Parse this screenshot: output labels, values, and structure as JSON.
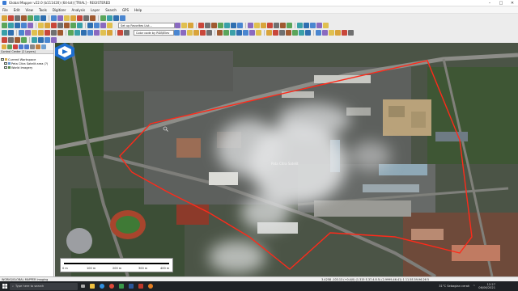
{
  "window": {
    "title": "Global Mapper v22.0 (b111420) (64-bit) [TRIAL] - REGISTERED",
    "controls": [
      "–",
      "□",
      "✕"
    ]
  },
  "menu": [
    "File",
    "Edit",
    "View",
    "Tools",
    "Digitizer",
    "Analysis",
    "Layer",
    "Search",
    "GPS",
    "Help"
  ],
  "toolbar": {
    "favorites_select": "Set up Favorites List...",
    "color_select": "Color code by RGB/Elev"
  },
  "control_center": {
    "header": "Control Center (2 Layers)",
    "tree": [
      {
        "label": "Current Workspace",
        "checked": true
      },
      {
        "label": "Peta Citra Satelit area (?)",
        "checked": true
      },
      {
        "label": "World Imagery",
        "checked": true
      }
    ]
  },
  "map": {
    "place_label": "Pata Citra Satelit",
    "scale": {
      "ticks": [
        "0 m",
        "100 m",
        "200 m",
        "300 m",
        "400 m"
      ]
    },
    "boundary_color": "#ff2a1a"
  },
  "statusbar": {
    "left": "WORKS/GLOBAL MAPPER Imaging",
    "coords": "3.4258 -103.13 (+0.4/0) (1.315 E,37,4.8.5) (2,9999,46.41) 1 11.5E.59,96.26 5"
  },
  "taskbar": {
    "search_placeholder": "Type here to search",
    "weather": "31°C Sebagian cerah",
    "time": "12:27",
    "date": "06/06/2021"
  },
  "colors": {
    "accent": "#3a7bd5",
    "boundary": "#ff2a1a",
    "taskbar": "#1f2226"
  }
}
